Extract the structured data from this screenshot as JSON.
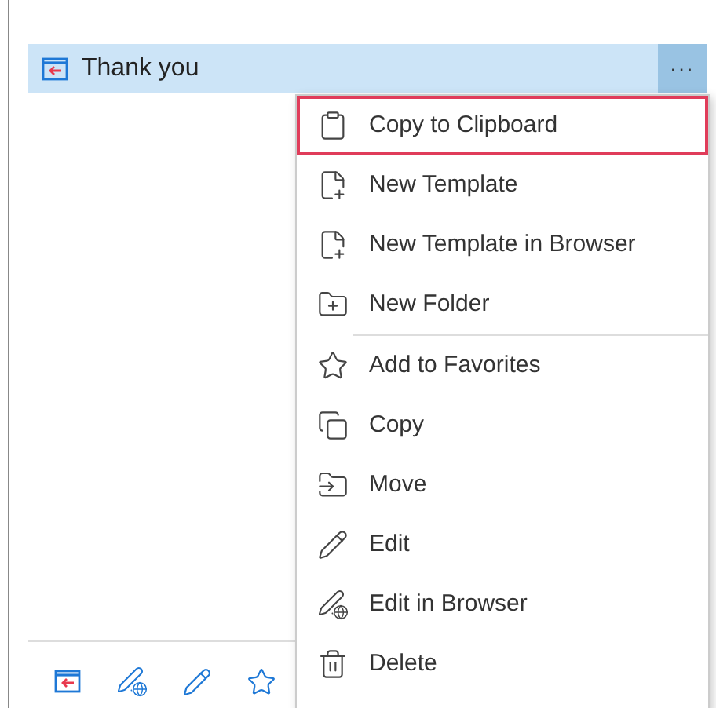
{
  "template": {
    "title": "Thank you",
    "selected": true,
    "more_button": "···"
  },
  "menu": [
    {
      "label": "Copy to Clipboard",
      "kind": "clipboard",
      "selected": true,
      "divider_after": false
    },
    {
      "label": "New Template",
      "kind": "new-template",
      "selected": false,
      "divider_after": false
    },
    {
      "label": "New Template in Browser",
      "kind": "new-template",
      "selected": false,
      "divider_after": false
    },
    {
      "label": "New Folder",
      "kind": "new-folder",
      "selected": false,
      "divider_after": true
    },
    {
      "label": "Add to Favorites",
      "kind": "star",
      "selected": false,
      "divider_after": false
    },
    {
      "label": "Copy",
      "kind": "copy",
      "selected": false,
      "divider_after": false
    },
    {
      "label": "Move",
      "kind": "move",
      "selected": false,
      "divider_after": false
    },
    {
      "label": "Edit",
      "kind": "edit",
      "selected": false,
      "divider_after": false
    },
    {
      "label": "Edit in Browser",
      "kind": "edit-browser",
      "selected": false,
      "divider_after": false
    },
    {
      "label": "Delete",
      "kind": "delete",
      "selected": false,
      "divider_after": false
    }
  ]
}
